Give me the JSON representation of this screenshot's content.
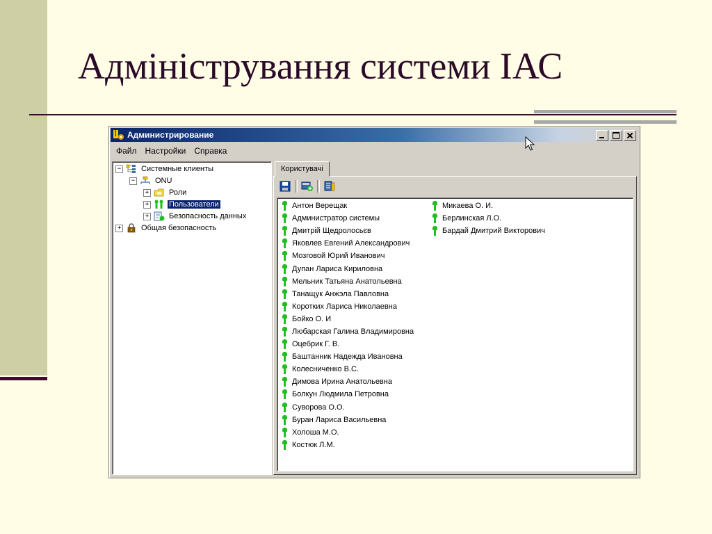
{
  "slide": {
    "title": "Адміністрування системи ІАС"
  },
  "window": {
    "title": "Администрирование",
    "controls": [
      "minimize",
      "maximize",
      "close"
    ]
  },
  "menu": [
    "Файл",
    "Настройки",
    "Справка"
  ],
  "tree": {
    "nodes": [
      {
        "label": "Системные клиенты",
        "expander": "−",
        "icon": "clients-tree-icon"
      },
      {
        "label": "ONU",
        "expander": "−",
        "icon": "onu-node-icon"
      },
      {
        "label": "Роли",
        "expander": "+",
        "icon": "roles-folder-icon"
      },
      {
        "label": "Пользователи",
        "expander": "+",
        "icon": "users-group-icon",
        "selected": true
      },
      {
        "label": "Безопасность данных",
        "expander": "+",
        "icon": "data-security-icon"
      },
      {
        "label": "Общая безопасность",
        "expander": "+",
        "icon": "lock-icon"
      }
    ]
  },
  "tab": {
    "label": "Користувачі"
  },
  "toolbar": {
    "buttons": [
      "save-icon",
      "add-user-icon",
      "properties-icon"
    ]
  },
  "users": {
    "column1": [
      "Антон Верещак",
      "Администратор системы",
      "Дмитрій Щедролосьєв",
      "Яковлев Евгений Александрович",
      "Мозговой Юрий Иванович",
      "Дупан Лариса Кириловна",
      "Мельник Татьяна Анатольевна",
      "Танащук Анжэла Павловна",
      "Коротких Лариса Николаевна",
      "Бойко О. И",
      "Любарская Галина Владимировна",
      "Оцебрик Г. В.",
      "Баштанник Надежда Ивановна",
      "Колесниченко В.С.",
      "Димова Ирина Анатольевна",
      "Болкун Людмила Петровна",
      "Суворова О.О.",
      "Буран Лариса Васильевна",
      "Холоша М.О.",
      "Костюк Л.М."
    ],
    "column2": [
      "Микаева О. И.",
      "Берлинская Л.О.",
      "Бардай Дмитрий Викторович"
    ]
  },
  "colors": {
    "title_text": "#2a0a28",
    "slide_bg": "#fffde6",
    "titlebar_start": "#0a246a",
    "user_icon": "#1fbf1f",
    "selection": "#0a246a"
  }
}
